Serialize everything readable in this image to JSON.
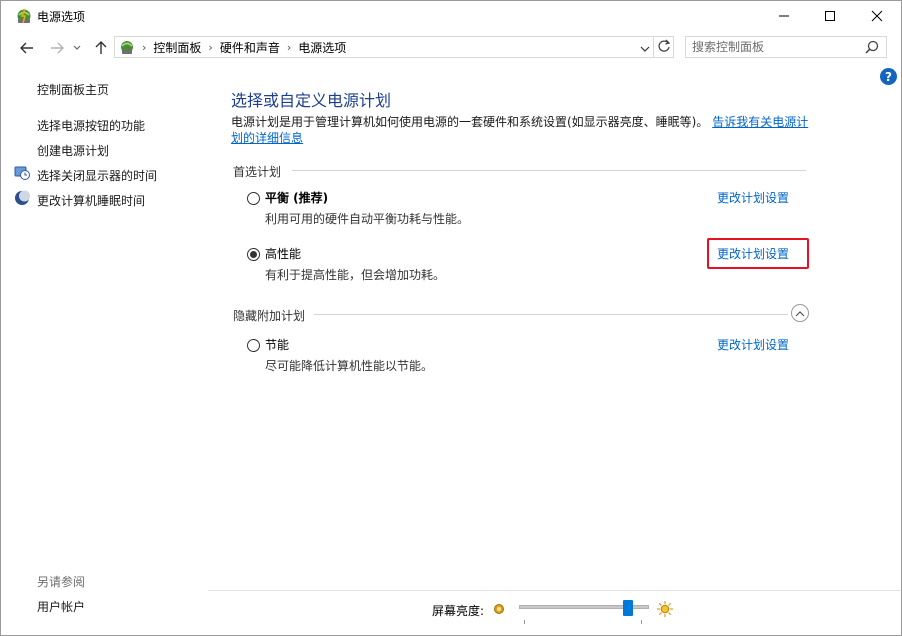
{
  "window": {
    "title": "电源选项",
    "minimize_glyph": "—",
    "maximize_glyph": "☐",
    "close_glyph": "✕"
  },
  "address": {
    "crumbs": [
      "控制面板",
      "硬件和声音",
      "电源选项"
    ],
    "search_placeholder": "搜索控制面板"
  },
  "sidebar": {
    "home": "控制面板主页",
    "links": [
      "选择电源按钮的功能",
      "创建电源计划",
      "选择关闭显示器的时间",
      "更改计算机睡眠时间"
    ],
    "see_also_title": "另请参阅",
    "see_also_link": "用户帐户"
  },
  "main": {
    "heading": "选择或自定义电源计划",
    "description_line1": "电源计划是用于管理计算机如何使用电源的一套硬件和系统设置(如显示器亮度、睡眠等)。",
    "description_link1": "告诉我有关电源计",
    "description_link2": "划的详细信息",
    "preferred_title": "首选计划",
    "hidden_title": "隐藏附加计划",
    "plans": [
      {
        "name": "平衡 (推荐)",
        "desc": "利用可用的硬件自动平衡功耗与性能。",
        "link": "更改计划设置",
        "selected": false
      },
      {
        "name": "高性能",
        "desc": "有利于提高性能，但会增加功耗。",
        "link": "更改计划设置",
        "selected": true
      },
      {
        "name": "节能",
        "desc": "尽可能降低计算机性能以节能。",
        "link": "更改计划设置",
        "selected": false
      }
    ]
  },
  "footer": {
    "brightness_label": "屏幕亮度:",
    "brightness_level": 0.86
  },
  "colors": {
    "heading": "#1e3f8f",
    "link": "#0066cc",
    "highlight_box": "#e81123",
    "slider_thumb": "#0078d7"
  }
}
